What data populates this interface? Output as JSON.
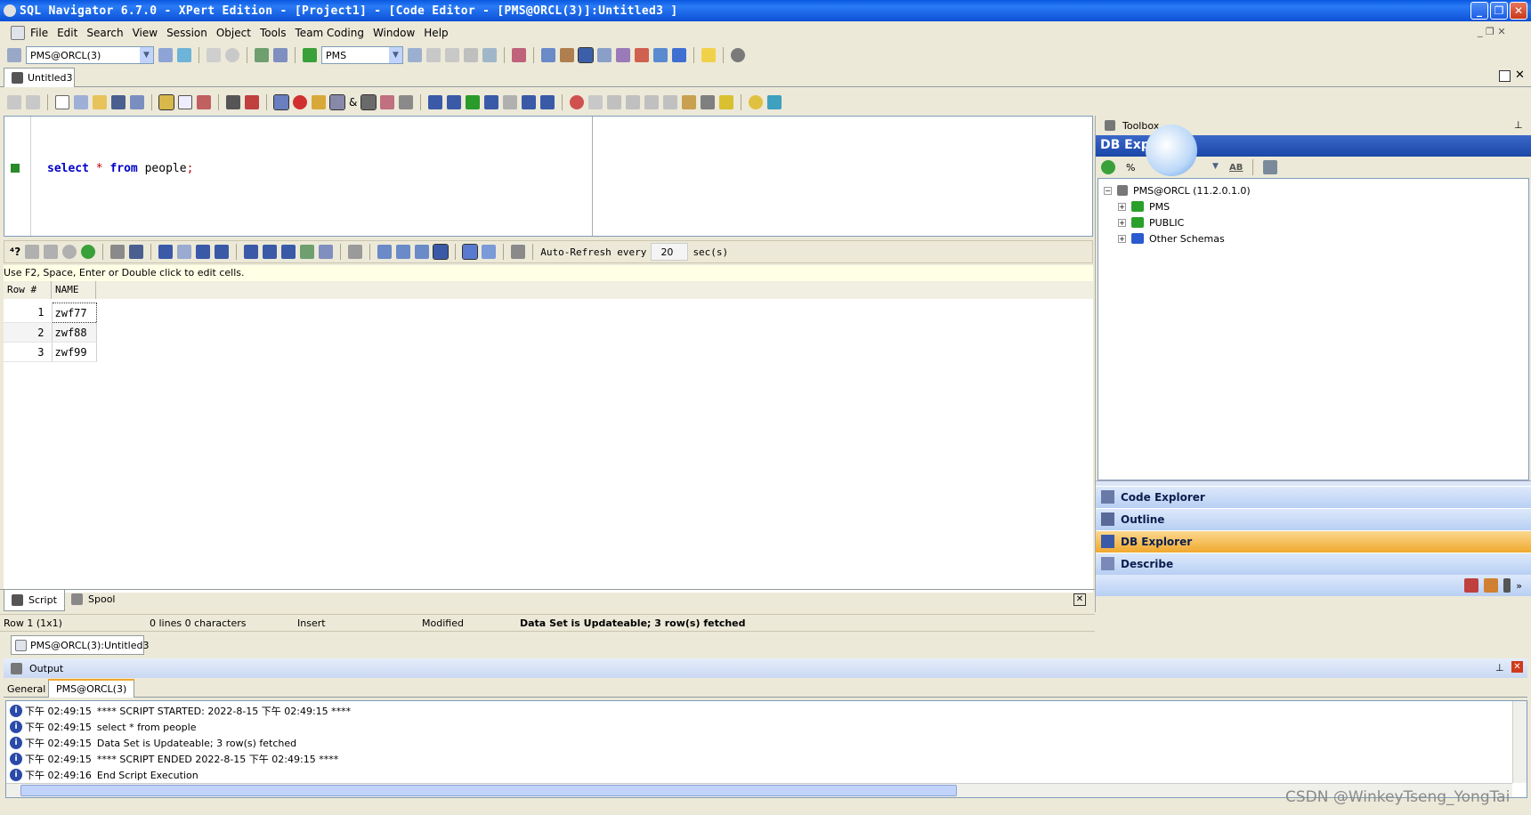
{
  "window": {
    "title": "SQL Navigator 6.7.0 - XPert Edition - [Project1] - [Code Editor - [PMS@ORCL(3)]:Untitled3 ]"
  },
  "menu": [
    "File",
    "Edit",
    "Search",
    "View",
    "Session",
    "Object",
    "Tools",
    "Team Coding",
    "Window",
    "Help"
  ],
  "toolbar": {
    "connection": "PMS@ORCL(3)",
    "schema": "PMS"
  },
  "editor_tab": "Untitled3",
  "editor": {
    "kw1": "select",
    "op": "*",
    "kw2": "from",
    "ident": "people",
    "semi": ";"
  },
  "results": {
    "auto_refresh_label": "Auto-Refresh every",
    "auto_refresh_value": "20",
    "auto_refresh_unit": "sec(s)",
    "hint": "Use F2, Space, Enter or Double click to edit cells.",
    "columns": [
      "Row #",
      "NAME"
    ],
    "rows": [
      [
        "1",
        "zwf77"
      ],
      [
        "2",
        "zwf88"
      ],
      [
        "3",
        "zwf99"
      ]
    ]
  },
  "bottom_tabs": {
    "script": "Script",
    "spool": "Spool"
  },
  "statusbar": {
    "position": "Row 1 (1x1)",
    "lines": "0 lines 0 characters",
    "mode": "Insert",
    "modified": "Modified",
    "message": "Data Set is Updateable; 3 row(s) fetched"
  },
  "doc_tab": "PMS@ORCL(3):Untitled3",
  "toolbox": {
    "title": "Toolbox",
    "db_explorer_title": "DB Explo",
    "filter": "%",
    "filter_btn": "AB",
    "tree": {
      "root": "PMS@ORCL (11.2.0.1.0)",
      "children": [
        "PMS",
        "PUBLIC",
        "Other Schemas"
      ]
    },
    "panels": [
      "Code Explorer",
      "Outline",
      "DB Explorer",
      "Describe"
    ]
  },
  "output": {
    "title": "Output",
    "tabs": [
      "General",
      "PMS@ORCL(3)"
    ],
    "lines": [
      {
        "time": "下午 02:49:15",
        "text": "**** SCRIPT STARTED: 2022-8-15 下午 02:49:15 ****"
      },
      {
        "time": "下午 02:49:15",
        "text": "select * from people"
      },
      {
        "time": "下午 02:49:15",
        "text": "Data Set is Updateable; 3 row(s) fetched"
      },
      {
        "time": "下午 02:49:15",
        "text": "**** SCRIPT ENDED 2022-8-15 下午 02:49:15 ****"
      },
      {
        "time": "下午 02:49:16",
        "text": "End Script Execution"
      }
    ]
  },
  "watermark": "CSDN @WinkeyTseng_YongTai"
}
